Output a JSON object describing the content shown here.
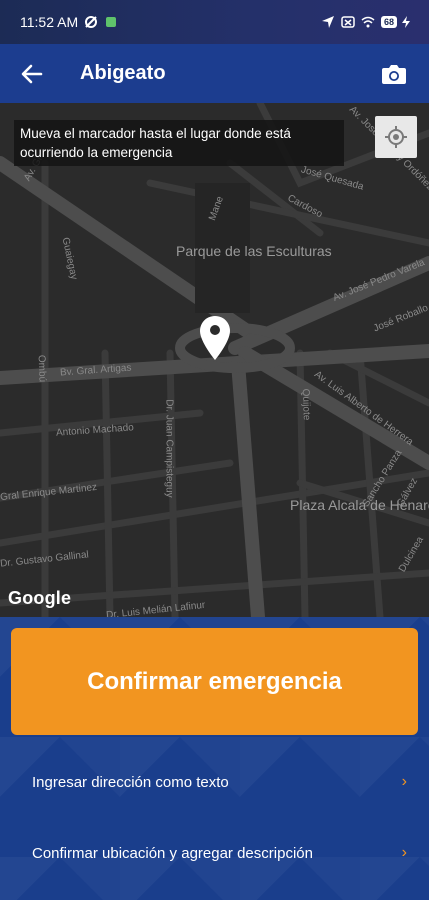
{
  "status_bar": {
    "time": "11:52 AM",
    "battery": "68"
  },
  "app_bar": {
    "title": "Abigeato"
  },
  "map": {
    "instruction": "Mueva el marcador hasta el lugar donde está ocurriendo la emergencia",
    "attribution": "Google",
    "labels": {
      "park": "Parque de las Esculturas",
      "plaza": "Plaza Alcala de Henares",
      "street_artigas": "Bv. Gral. Artigas",
      "street_machado": "Antonio Machado",
      "street_martinez": "Gral Enrique Martinez",
      "street_galinal": "Dr. Gustavo Gallinal",
      "street_lafinur": "Dr. Luis Melián Lafinur",
      "street_campisteguy": "Dr. Juan Campisteguy",
      "street_herrera": "Av. Luis Alberto de Herrera",
      "street_varela": "Av. José Pedro Varela",
      "street_quesada": "José Quesada",
      "street_ordonez": "Av. José Batlle y Ordóñez",
      "street_cardoso": "Cardoso",
      "street_mane": "Mane",
      "street_guasi": "Guaiegay",
      "street_quijote": "Quijote",
      "street_sancho": "Sancho Panza",
      "street_ombu": "Ombú",
      "street_galvez": "Gálvez",
      "street_dulcinea": "Dulcinea",
      "street_roballo": "José Roballo",
      "street_av_gr": "Av. Gr"
    }
  },
  "actions": {
    "confirm": "Confirmar emergencia",
    "option_text_address": "Ingresar dirección como texto",
    "option_description": "Confirmar ubicación y agregar descripción",
    "chevron": "›"
  },
  "colors": {
    "primary": "#1c3d8f",
    "accent": "#f29520",
    "map_bg": "#2b2b2b"
  },
  "icons": {
    "back": "arrow-left-icon",
    "camera": "camera-icon",
    "locate": "my-location-icon",
    "marker": "map-pin-icon"
  }
}
